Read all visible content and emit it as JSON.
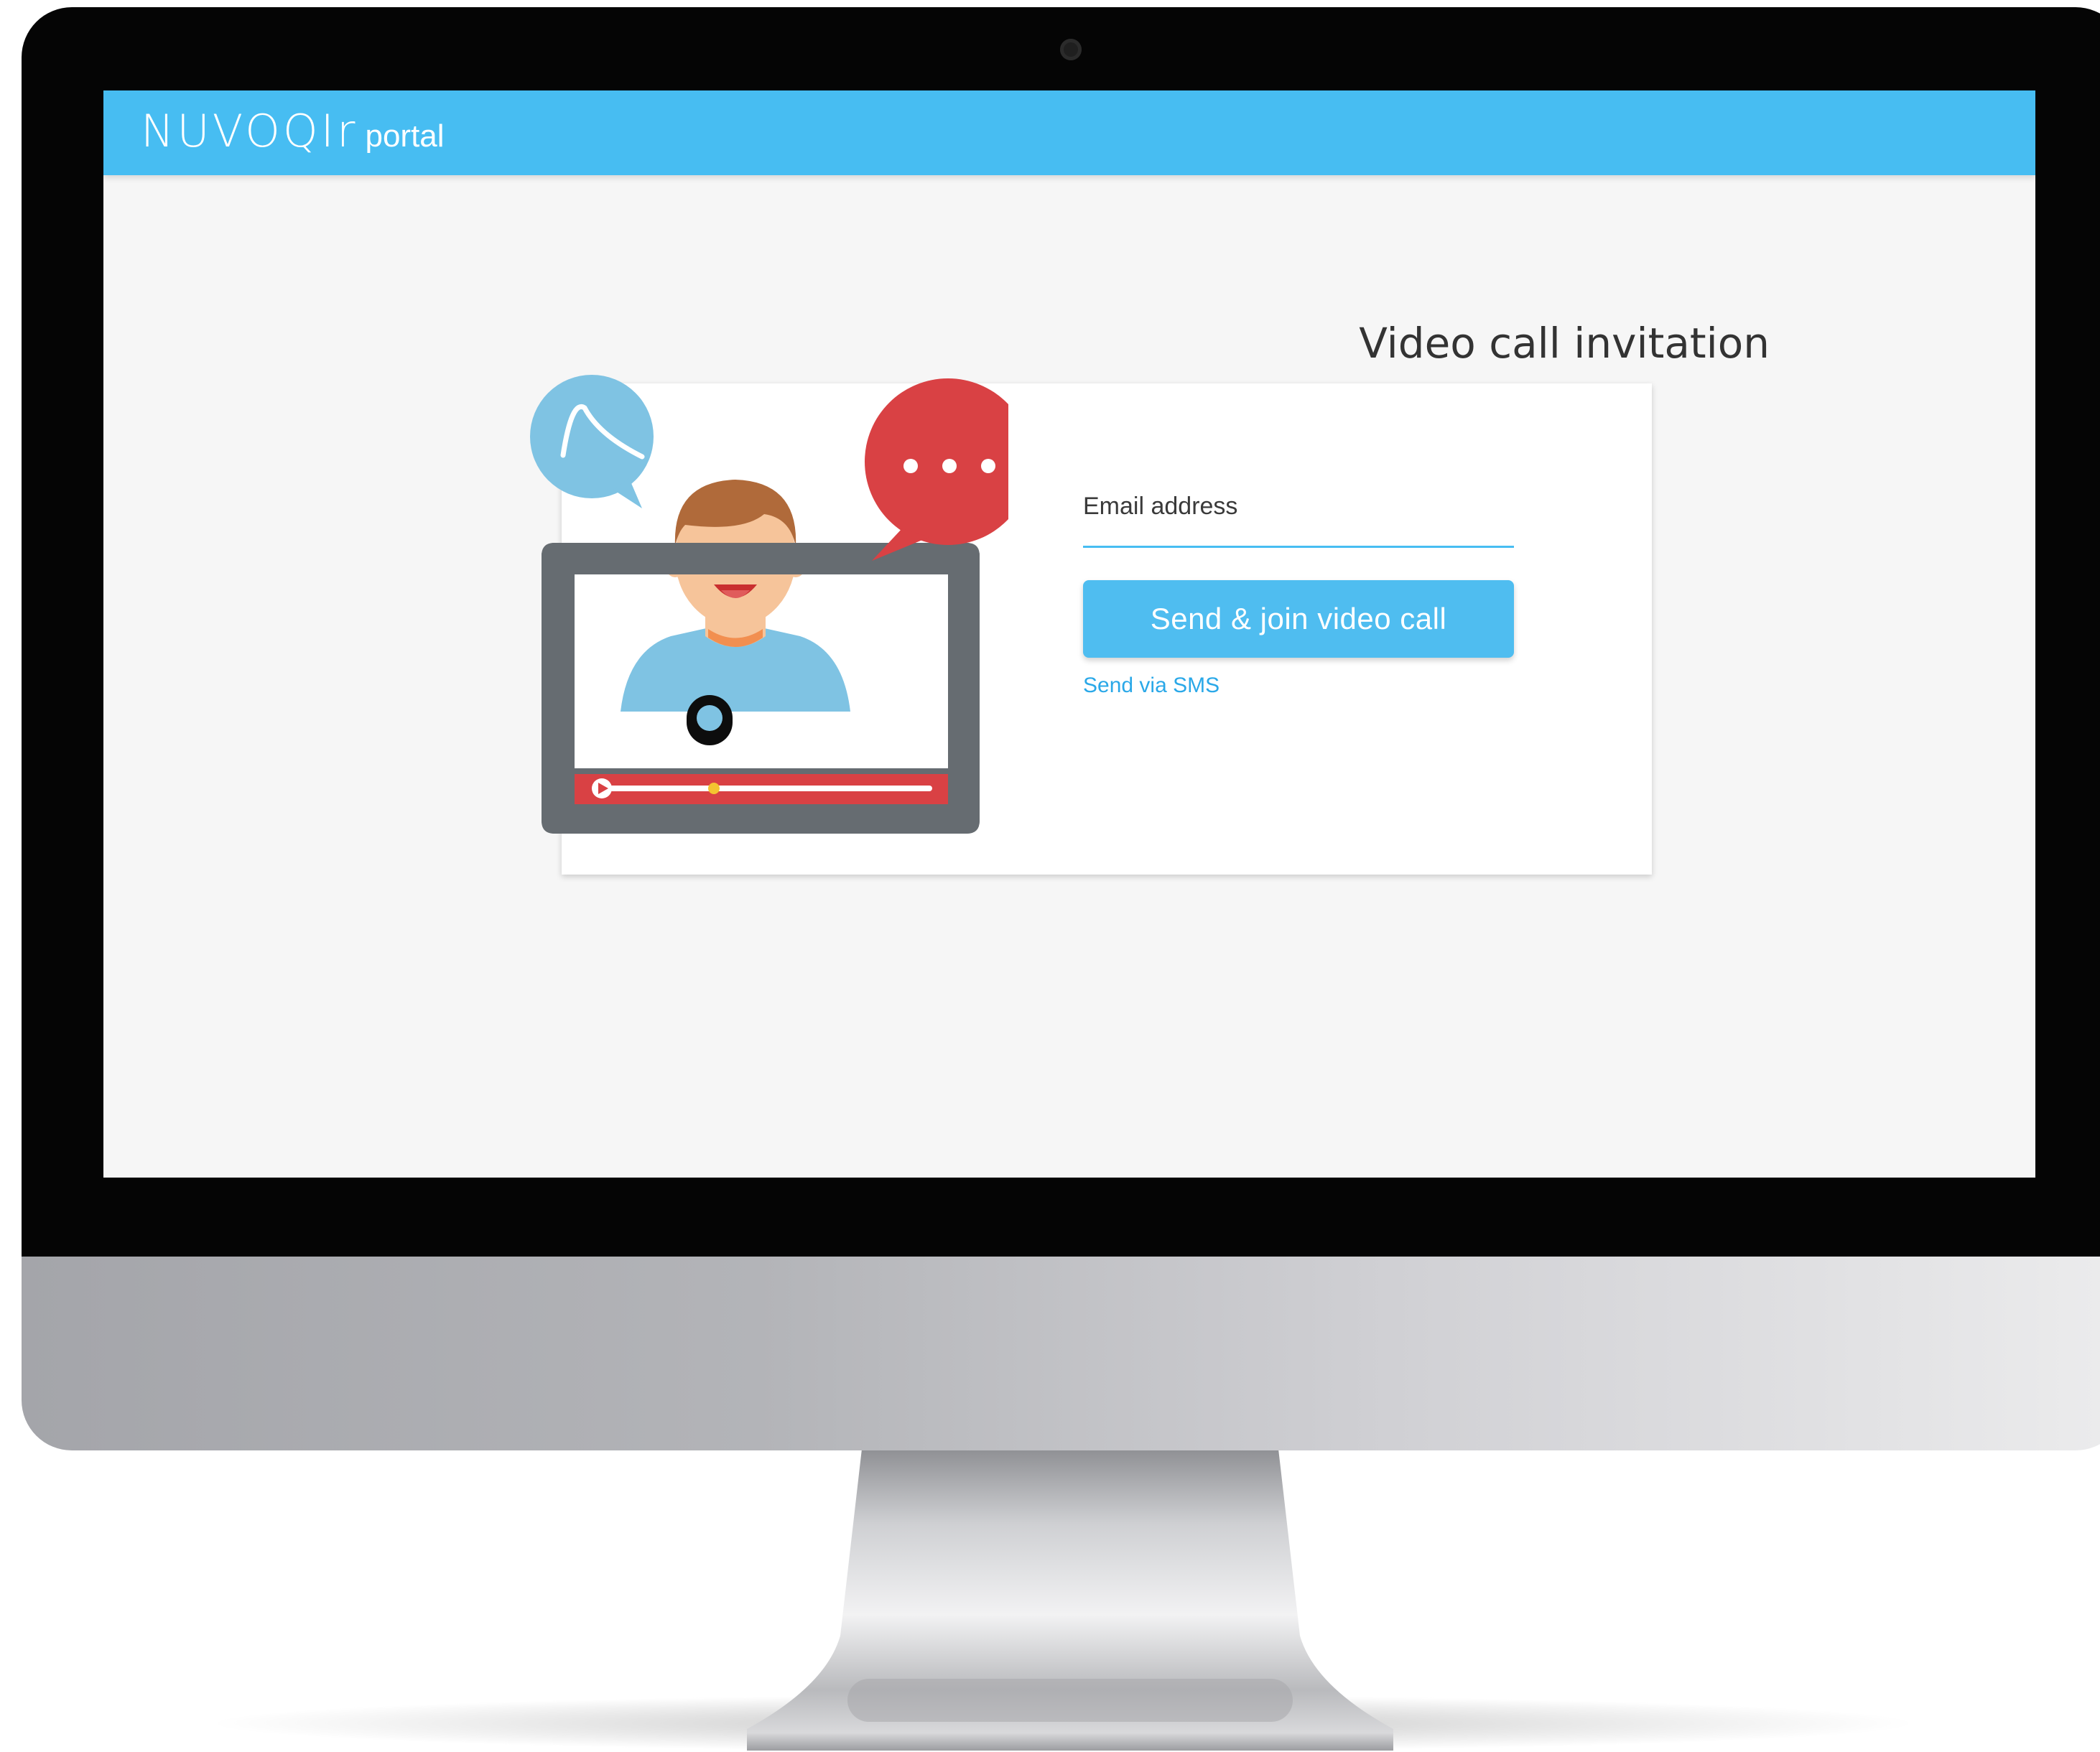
{
  "app": {
    "brand": "NUVOQIr",
    "brand_sub": "portal"
  },
  "page": {
    "title": "Video call invitation"
  },
  "form": {
    "email_label": "Email address",
    "email_value": "",
    "send_button_label": "Send & join video call",
    "sms_link_label": "Send via SMS"
  },
  "colors": {
    "accent": "#47bdf2",
    "button": "#4fbdf0",
    "link": "#2aa8e8",
    "chat_bubble_red": "#d94144",
    "chat_bubble_blue": "#7fc3e3"
  },
  "icons": {
    "illustration": "video-call-illustration",
    "chat_bubbles": [
      "curve-chat-bubble-icon",
      "ellipsis-chat-bubble-icon"
    ]
  }
}
